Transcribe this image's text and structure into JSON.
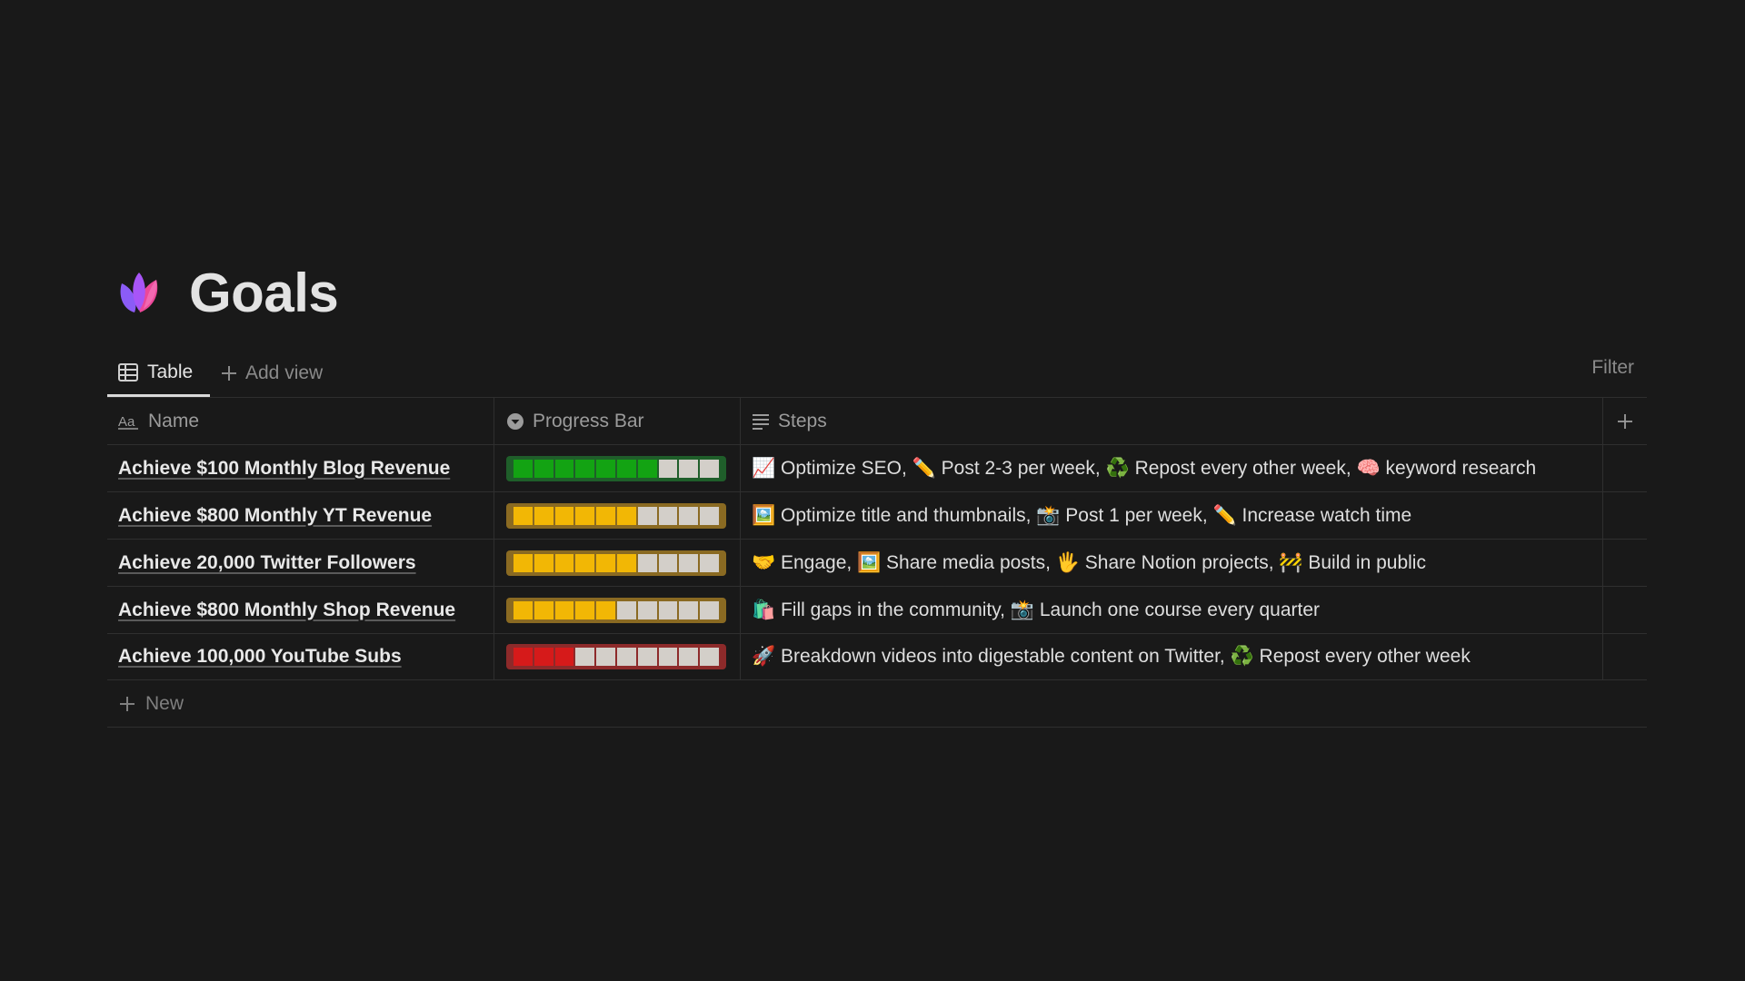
{
  "page": {
    "title": "Goals"
  },
  "tabs": {
    "active": "Table",
    "add_view": "Add view",
    "filter": "Filter"
  },
  "columns": {
    "name": "Name",
    "progress": "Progress Bar",
    "steps": "Steps"
  },
  "colors": {
    "green": "#13a313",
    "yellow": "#f2b705",
    "red": "#d61a1a",
    "empty": "#d3cfc9",
    "frame_green": "#1f5e2a",
    "frame_yellow": "#8a6a22",
    "frame_red": "#8d2a2a"
  },
  "rows": [
    {
      "name": "Achieve $100 Monthly Blog Revenue",
      "progress_level": 0.7,
      "progress_color": "green",
      "steps": "📈 Optimize SEO, ✏️ Post 2-3 per week, ♻️ Repost every other week, 🧠 keyword research"
    },
    {
      "name": "Achieve $800 Monthly YT Revenue",
      "progress_level": 0.6,
      "progress_color": "yellow",
      "steps": "🖼️ Optimize title and thumbnails, 📸 Post 1 per week, ✏️ Increase watch time"
    },
    {
      "name": "Achieve 20,000 Twitter Followers",
      "progress_level": 0.6,
      "progress_color": "yellow",
      "steps": "🤝 Engage, 🖼️ Share media posts, 🖐️ Share Notion projects, 🚧 Build in public"
    },
    {
      "name": "Achieve $800 Monthly Shop Revenue",
      "progress_level": 0.5,
      "progress_color": "yellow",
      "steps": "🛍️ Fill gaps in the community, 📸 Launch one course every quarter"
    },
    {
      "name": "Achieve 100,000 YouTube Subs",
      "progress_level": 0.3,
      "progress_color": "red",
      "steps": "🚀 Breakdown videos into digestable content on Twitter, ♻️ Repost every other week"
    }
  ],
  "new_row": {
    "label": "New"
  }
}
